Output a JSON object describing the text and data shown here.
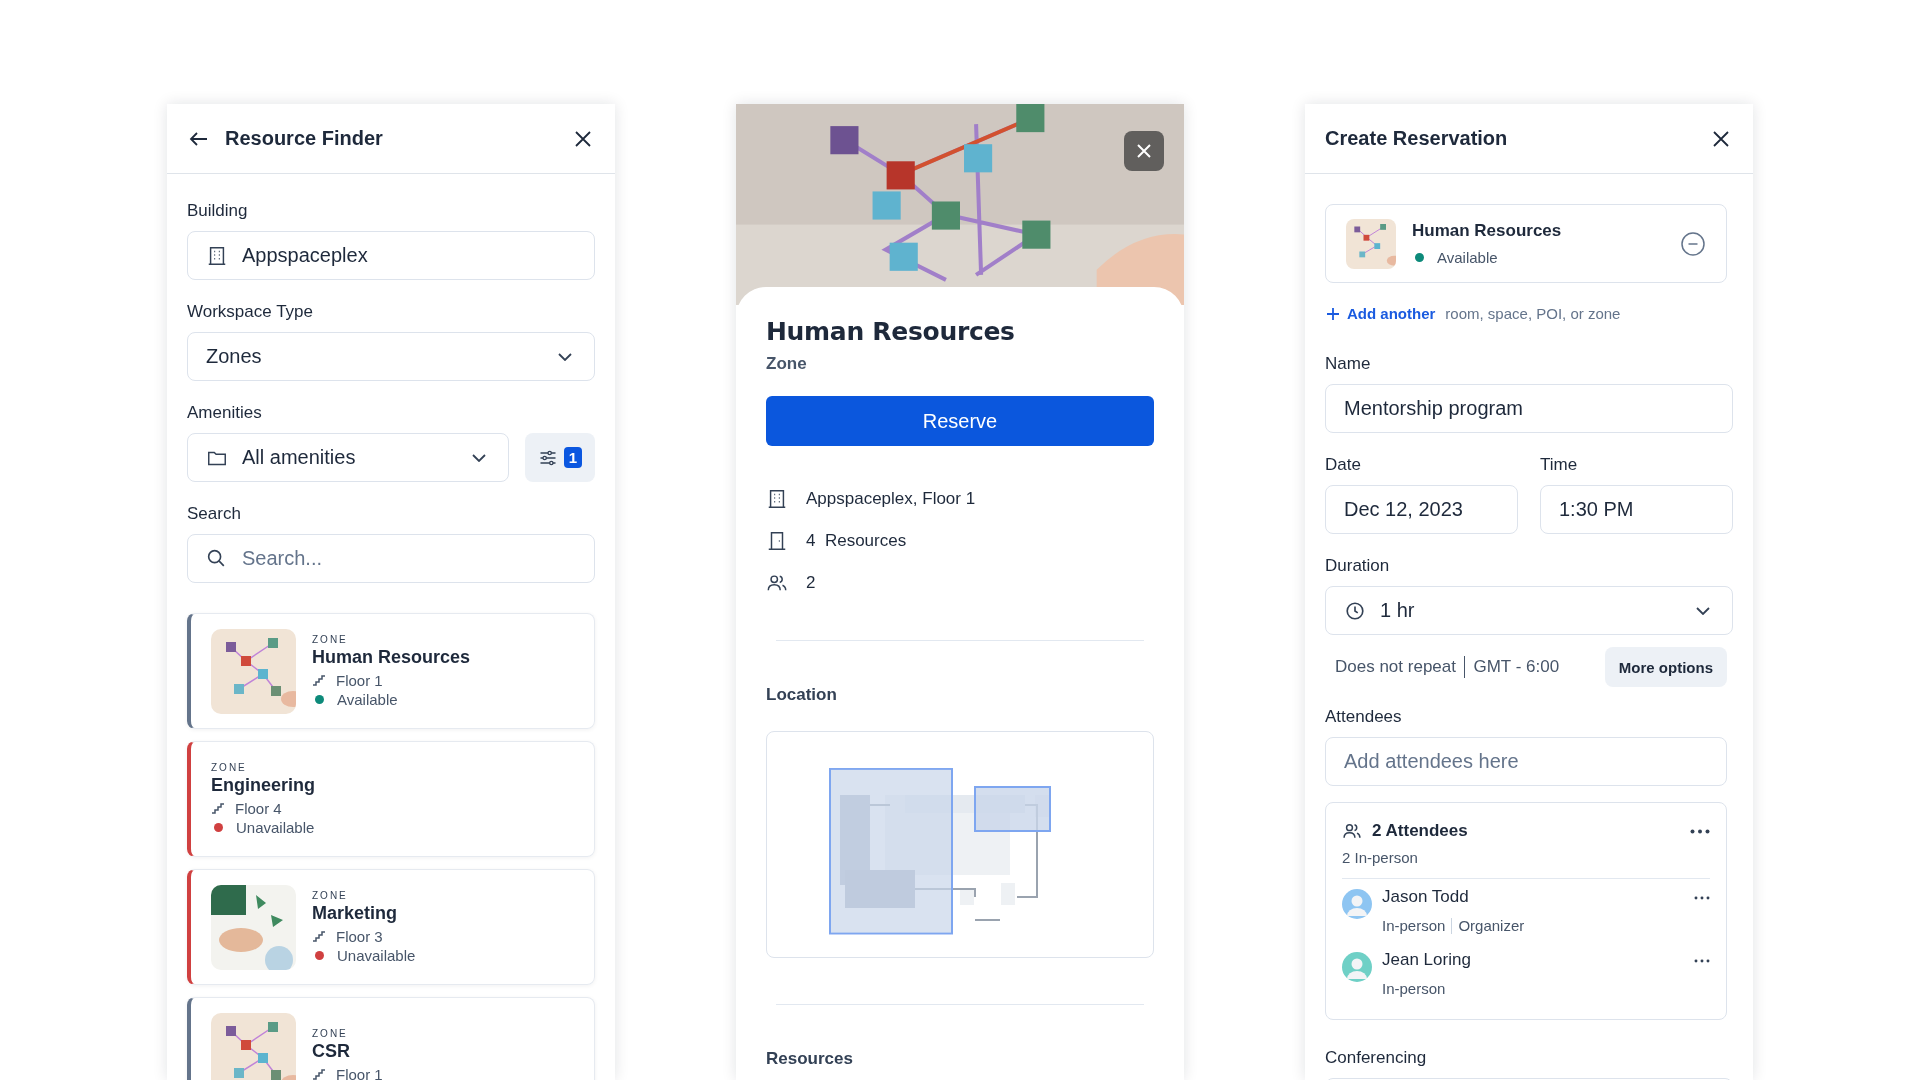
{
  "finder": {
    "title": "Resource Finder",
    "building": {
      "label": "Building",
      "value": "Appspaceplex"
    },
    "workspace_type": {
      "label": "Workspace Type",
      "value": "Zones"
    },
    "amenities": {
      "label": "Amenities",
      "value": "All amenities",
      "filter_count": "1"
    },
    "search": {
      "label": "Search",
      "placeholder": "Search..."
    },
    "results": [
      {
        "type_label": "ZONE",
        "name": "Human Resources",
        "floor": "Floor 1",
        "status": "Available",
        "available": true,
        "thumbnail": true
      },
      {
        "type_label": "ZONE",
        "name": "Engineering",
        "floor": "Floor 4",
        "status": "Unavailable",
        "available": false,
        "thumbnail": false
      },
      {
        "type_label": "ZONE",
        "name": "Marketing",
        "floor": "Floor 3",
        "status": "Unavailable",
        "available": false,
        "thumbnail": true
      },
      {
        "type_label": "ZONE",
        "name": "CSR",
        "floor": "Floor 1",
        "available": true,
        "thumbnail": true
      }
    ]
  },
  "detail": {
    "title": "Human Resources",
    "subtitle": "Zone",
    "reserve_button": "Reserve",
    "info": [
      {
        "kind": "building",
        "text": "Appspaceplex, Floor 1"
      },
      {
        "kind": "door",
        "text": "4  Resources"
      },
      {
        "kind": "people",
        "text": "2"
      }
    ],
    "location_label": "Location",
    "resources_label": "Resources"
  },
  "reservation": {
    "title": "Create Reservation",
    "resource": {
      "name": "Human Resources",
      "status": "Available",
      "available": true
    },
    "add_link": "Add another",
    "add_hint": "room, space, POI, or zone",
    "name": {
      "label": "Name",
      "value": "Mentorship program"
    },
    "date": {
      "label": "Date",
      "value": "Dec 12, 2023"
    },
    "time": {
      "label": "Time",
      "value": "1:30 PM"
    },
    "duration": {
      "label": "Duration",
      "value": "1 hr"
    },
    "repeat": "Does not repeat",
    "timezone": "GMT - 6:00",
    "more_options": "More options",
    "attendees": {
      "label": "Attendees",
      "placeholder": "Add attendees here",
      "summary": "2 Attendees",
      "breakdown": "2 In-person",
      "people": [
        {
          "name": "Jason Todd",
          "roles": [
            "In-person",
            "Organizer"
          ]
        },
        {
          "name": "Jean Loring",
          "roles": [
            "In-person"
          ]
        }
      ]
    },
    "conferencing_label": "Conferencing"
  }
}
